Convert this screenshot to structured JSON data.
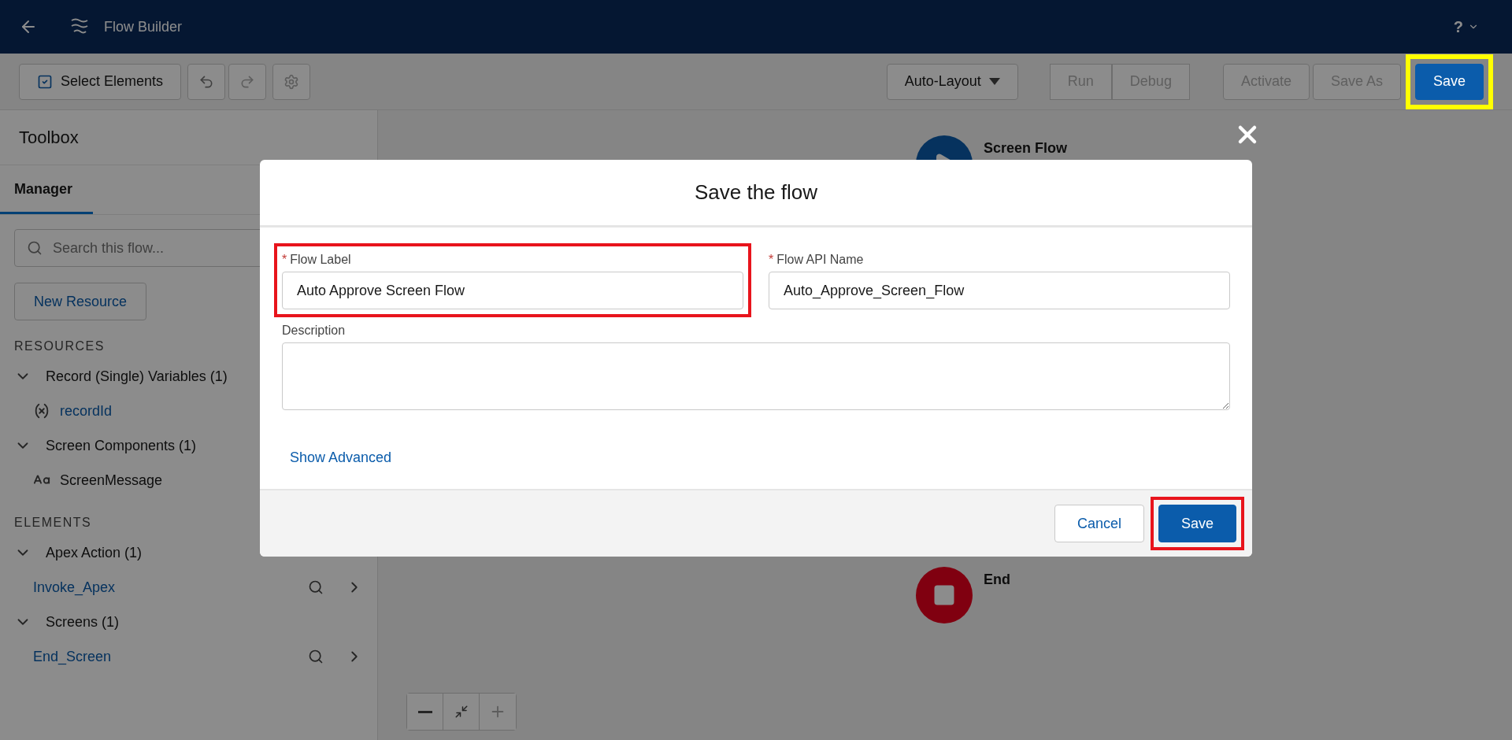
{
  "header": {
    "title": "Flow Builder",
    "help": "?"
  },
  "toolbar": {
    "select_elements": "Select Elements",
    "layout": "Auto-Layout",
    "buttons": [
      {
        "label": "Run",
        "kind": "group",
        "disabled": true
      },
      {
        "label": "Debug",
        "kind": "group",
        "disabled": true
      },
      {
        "label": "Activate",
        "kind": "plain",
        "disabled": true
      },
      {
        "label": "Save As",
        "kind": "plain",
        "disabled": true
      },
      {
        "label": "Save",
        "kind": "primary",
        "disabled": false,
        "highlighted": true
      }
    ]
  },
  "sidebar": {
    "title": "Toolbox",
    "tabs": [
      {
        "label": "Manager",
        "selected": true
      }
    ],
    "search": {
      "placeholder": "Search this flow..."
    },
    "new_resource": "New Resource",
    "sections": [
      {
        "heading": "RESOURCES",
        "groups": [
          {
            "label": "Record (Single) Variables (1)",
            "expanded": true,
            "items": [
              {
                "label": "recordId",
                "kind": "variable"
              }
            ]
          },
          {
            "label": "Screen Components (1)",
            "expanded": true,
            "items": [
              {
                "label": "ScreenMessage",
                "kind": "text"
              }
            ]
          }
        ]
      },
      {
        "heading": "ELEMENTS",
        "groups": [
          {
            "label": "Apex Action (1)",
            "expanded": true,
            "items": [
              {
                "label": "Invoke_Apex",
                "kind": "element"
              }
            ]
          },
          {
            "label": "Screens (1)",
            "expanded": true,
            "items": [
              {
                "label": "End_Screen",
                "kind": "element"
              }
            ]
          }
        ]
      }
    ]
  },
  "canvas": {
    "nodes": [
      {
        "kind": "start",
        "label": "Screen Flow"
      },
      {
        "kind": "end",
        "label": "End"
      }
    ]
  },
  "modal": {
    "title": "Save the flow",
    "fields": [
      {
        "label": "Flow Label",
        "required_mark": "*",
        "value": "Auto Approve Screen Flow",
        "highlighted": true
      },
      {
        "label": "Flow API Name",
        "required_mark": "*",
        "value": "Auto_Approve_Screen_Flow",
        "highlighted": false
      }
    ],
    "description": {
      "label": "Description"
    },
    "link": "Show Advanced",
    "buttons": [
      {
        "label": "Cancel",
        "kind": "neutral",
        "highlighted": false
      },
      {
        "label": "Save",
        "kind": "brand",
        "highlighted": true
      }
    ]
  }
}
